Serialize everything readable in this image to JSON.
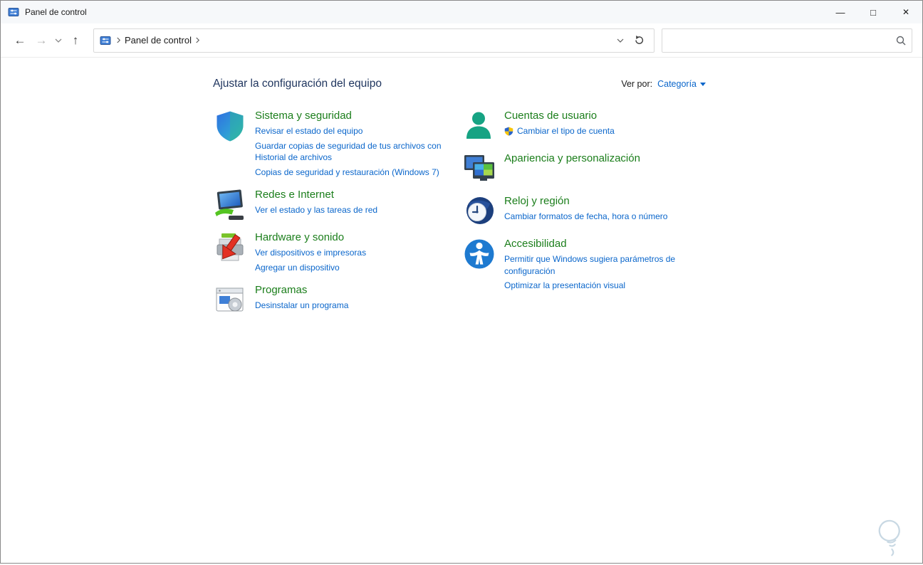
{
  "window": {
    "title": "Panel de control"
  },
  "icons": {
    "back": "←",
    "forward": "→",
    "up": "↑",
    "minimize": "—",
    "maximize": "□",
    "close": "✕"
  },
  "address_bar": {
    "location": "Panel de control"
  },
  "search": {
    "placeholder": "",
    "value": ""
  },
  "content": {
    "heading": "Ajustar la configuración del equipo",
    "view_by_label": "Ver por:",
    "view_by_value": "Categoría"
  },
  "categories": {
    "left": [
      {
        "title": "Sistema y seguridad",
        "links": [
          "Revisar el estado del equipo",
          "Guardar copias de seguridad de tus archivos con Historial de archivos",
          "Copias de seguridad y restauración (Windows 7)"
        ]
      },
      {
        "title": "Redes e Internet",
        "links": [
          "Ver el estado y las tareas de red"
        ]
      },
      {
        "title": "Hardware y sonido",
        "links": [
          "Ver dispositivos e impresoras",
          "Agregar un dispositivo"
        ]
      },
      {
        "title": "Programas",
        "links": [
          "Desinstalar un programa"
        ]
      }
    ],
    "right": [
      {
        "title": "Cuentas de usuario",
        "links": [
          "Cambiar el tipo de cuenta"
        ]
      },
      {
        "title": "Apariencia y personalización",
        "links": []
      },
      {
        "title": "Reloj y región",
        "links": [
          "Cambiar formatos de fecha, hora o número"
        ]
      },
      {
        "title": "Accesibilidad",
        "links": [
          "Permitir que Windows sugiera parámetros de configuración",
          "Optimizar la presentación visual"
        ]
      }
    ]
  },
  "colors": {
    "category_title_green": "#1b7e1b",
    "link_blue": "#0a66cb",
    "heading_navy": "#20365f"
  }
}
